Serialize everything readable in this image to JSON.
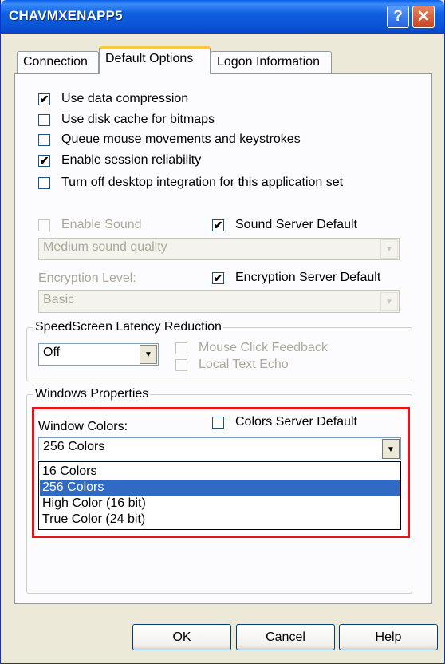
{
  "window": {
    "title": "CHAVMXENAPP5",
    "help_glyph": "?",
    "close_glyph": "✕"
  },
  "tabs": [
    "Connection",
    "Default Options",
    "Logon Information"
  ],
  "options": [
    {
      "label": "Use data compression",
      "checked": true
    },
    {
      "label": "Use disk cache for bitmaps",
      "checked": false
    },
    {
      "label": "Queue mouse movements and keystrokes",
      "checked": false
    },
    {
      "label": "Enable session reliability",
      "checked": true
    },
    {
      "label": "Turn off desktop integration for this application set",
      "checked": false
    }
  ],
  "sound": {
    "enable_label": "Enable Sound",
    "enable_checked": false,
    "server_default_label": "Sound Server Default",
    "server_default_checked": true,
    "quality_value": "Medium sound quality"
  },
  "encryption": {
    "label": "Encryption Level:",
    "server_default_label": "Encryption Server Default",
    "server_default_checked": true,
    "value": "Basic"
  },
  "speedscreen": {
    "title": "SpeedScreen Latency Reduction",
    "value": "Off",
    "mouse_click_label": "Mouse Click Feedback",
    "local_echo_label": "Local Text Echo"
  },
  "windows_properties": {
    "title": "Windows Properties",
    "colors_label": "Window Colors:",
    "colors_server_default_label": "Colors Server Default",
    "colors_server_default_checked": false,
    "selected_value": "256 Colors",
    "dropdown_options": [
      "16 Colors",
      "256 Colors",
      "High Color (16 bit)",
      "True Color (24 bit)"
    ],
    "highlighted_option": "256 Colors"
  },
  "buttons": {
    "ok": "OK",
    "cancel": "Cancel",
    "help": "Help"
  },
  "colors": {
    "titlebar": "#0a5ee8",
    "dialog_bg": "#ece9d8",
    "highlight_border": "#e8121a",
    "selection": "#316ac5"
  }
}
